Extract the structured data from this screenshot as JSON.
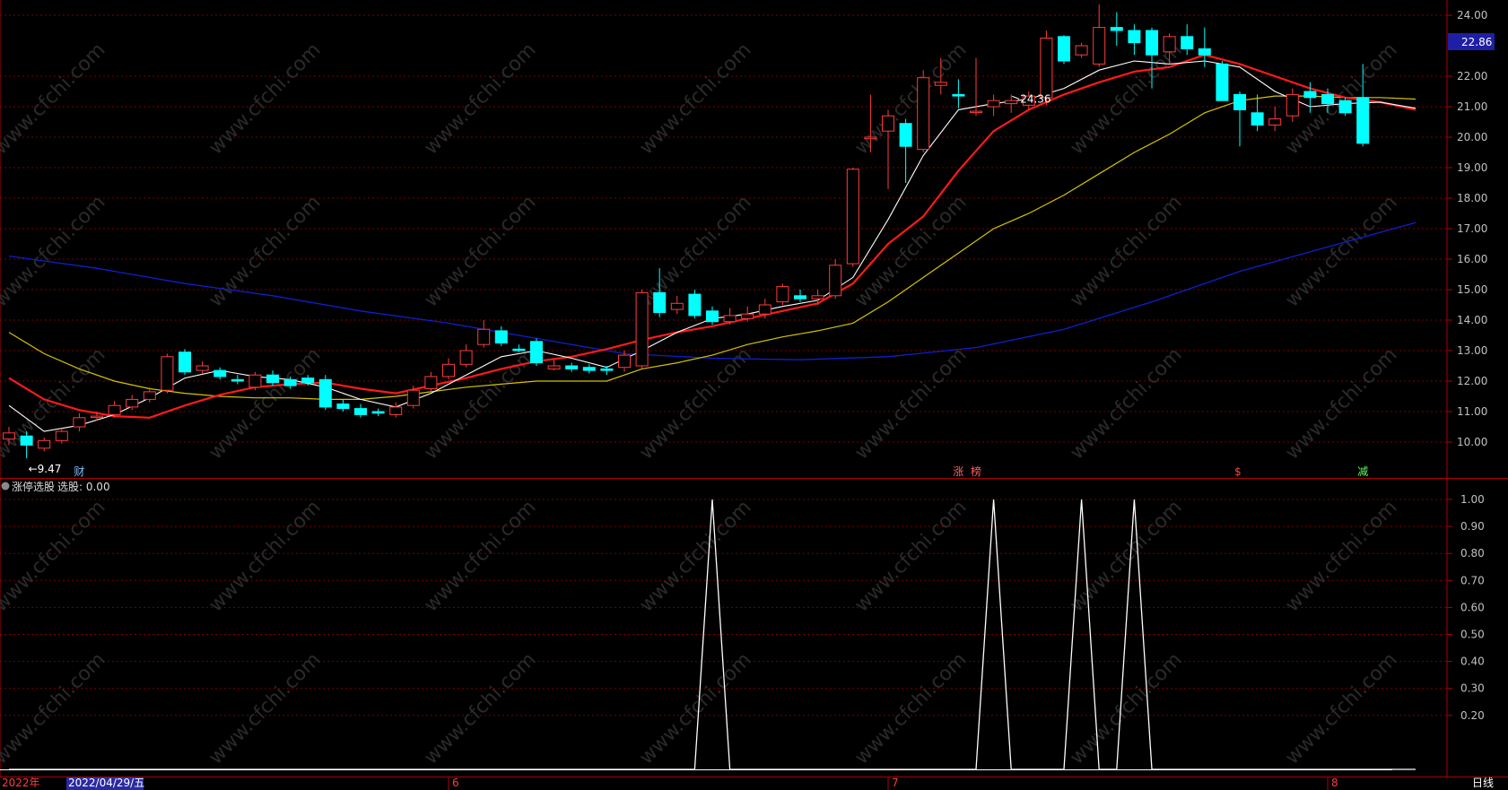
{
  "colors": {
    "background": "#000000",
    "grid": "#7a0000",
    "frame": "#b00000",
    "axis_text": "#c0c0c0",
    "up": "#ff3b3b",
    "down": "#00ffff",
    "ma_white": "#ffffff",
    "ma_red": "#ff1a1a",
    "ma_yellow": "#d4c400",
    "ma_blue": "#0f1fcf",
    "signal": "#ffffff",
    "current_price_bg": "#1f1fa6",
    "date_box_bg": "#2a2aa0"
  },
  "price_axis": {
    "ticks": [
      "24.00",
      "22.00",
      "21.00",
      "20.00",
      "19.00",
      "18.00",
      "17.00",
      "16.00",
      "15.00",
      "14.00",
      "13.00",
      "12.00",
      "11.00",
      "10.00"
    ],
    "current_price": "22.86"
  },
  "indicator_axis": {
    "ticks": [
      "1.00",
      "0.90",
      "0.80",
      "0.70",
      "0.60",
      "0.50",
      "0.40",
      "0.30",
      "0.20"
    ]
  },
  "indicator_header": {
    "name": "涨停选股",
    "value_text": "选股: 0.00"
  },
  "time_axis": {
    "year_label": "2022年",
    "date_box": "2022/04/29/五",
    "months": [
      {
        "label": "6",
        "index": 25
      },
      {
        "label": "7",
        "index": 50
      },
      {
        "label": "8",
        "index": 75
      }
    ]
  },
  "period_label": "日线",
  "extremes": {
    "high": {
      "label": "24.36",
      "index": 57
    },
    "low": {
      "label": "←9.47",
      "index": 1
    }
  },
  "event_markers": [
    {
      "label": "财",
      "index": 4,
      "color": "#7fbfff"
    },
    {
      "label": "涨",
      "index": 54,
      "color": "#ff6060"
    },
    {
      "label": "榜",
      "index": 55,
      "color": "#ff6060"
    },
    {
      "label": "$",
      "index": 70,
      "color": "#ff4040"
    },
    {
      "label": "减",
      "index": 77,
      "color": "#5fff5f"
    }
  ],
  "watermark": "www.cfchi.com",
  "chart_data": [
    {
      "type": "candlestick",
      "title": "日线",
      "ylim": [
        9.2,
        24.6
      ],
      "candles": [
        [
          10.1,
          10.3,
          9.9,
          10.5
        ],
        [
          10.2,
          9.9,
          9.47,
          10.35
        ],
        [
          9.8,
          10.05,
          9.7,
          10.15
        ],
        [
          10.05,
          10.35,
          9.95,
          10.45
        ],
        [
          10.5,
          10.8,
          10.35,
          10.95
        ],
        [
          10.85,
          10.85,
          10.7,
          11.0
        ],
        [
          10.9,
          11.2,
          10.8,
          11.35
        ],
        [
          11.15,
          11.4,
          11.05,
          11.55
        ],
        [
          11.4,
          11.65,
          11.3,
          11.8
        ],
        [
          11.7,
          12.8,
          11.6,
          12.9
        ],
        [
          12.95,
          12.3,
          12.2,
          13.05
        ],
        [
          12.35,
          12.5,
          12.25,
          12.65
        ],
        [
          12.35,
          12.15,
          12.05,
          12.45
        ],
        [
          12.05,
          12.0,
          11.9,
          12.2
        ],
        [
          11.8,
          12.2,
          11.7,
          12.3
        ],
        [
          12.2,
          11.95,
          11.85,
          12.35
        ],
        [
          12.05,
          11.85,
          11.75,
          12.15
        ],
        [
          12.1,
          11.95,
          11.85,
          12.2
        ],
        [
          12.05,
          11.15,
          11.05,
          12.2
        ],
        [
          11.25,
          11.1,
          11.0,
          11.4
        ],
        [
          11.1,
          10.9,
          10.8,
          11.25
        ],
        [
          11.0,
          10.95,
          10.85,
          11.1
        ],
        [
          10.9,
          11.15,
          10.8,
          11.3
        ],
        [
          11.2,
          11.7,
          11.1,
          11.85
        ],
        [
          11.75,
          12.15,
          11.65,
          12.3
        ],
        [
          12.15,
          12.55,
          12.05,
          12.75
        ],
        [
          12.55,
          13.0,
          12.45,
          13.2
        ],
        [
          13.2,
          13.7,
          13.1,
          14.0
        ],
        [
          13.65,
          13.25,
          13.15,
          13.8
        ],
        [
          13.05,
          13.0,
          12.95,
          13.2
        ],
        [
          13.3,
          12.6,
          12.5,
          13.4
        ],
        [
          12.4,
          12.5,
          12.35,
          12.7
        ],
        [
          12.5,
          12.4,
          12.3,
          12.6
        ],
        [
          12.45,
          12.35,
          12.25,
          12.55
        ],
        [
          12.4,
          12.35,
          12.2,
          12.5
        ],
        [
          12.45,
          12.85,
          12.3,
          13.0
        ],
        [
          12.5,
          14.9,
          12.4,
          15.0
        ],
        [
          14.9,
          14.25,
          14.1,
          15.7
        ],
        [
          14.35,
          14.55,
          14.2,
          14.8
        ],
        [
          14.85,
          14.15,
          14.05,
          15.0
        ],
        [
          14.3,
          13.95,
          13.85,
          14.45
        ],
        [
          13.95,
          14.15,
          13.85,
          14.4
        ],
        [
          14.05,
          14.2,
          13.95,
          14.45
        ],
        [
          14.2,
          14.5,
          14.05,
          14.7
        ],
        [
          14.6,
          15.1,
          14.5,
          15.2
        ],
        [
          14.8,
          14.7,
          14.6,
          15.0
        ],
        [
          14.7,
          14.8,
          14.5,
          15.0
        ],
        [
          14.8,
          15.8,
          14.7,
          16.0
        ],
        [
          15.85,
          18.95,
          15.75,
          19.0
        ],
        [
          19.95,
          20.0,
          19.5,
          21.4
        ],
        [
          20.2,
          20.7,
          18.3,
          20.9
        ],
        [
          20.45,
          19.7,
          18.5,
          20.6
        ],
        [
          19.6,
          21.95,
          19.5,
          22.2
        ],
        [
          21.7,
          21.8,
          21.4,
          22.6
        ],
        [
          21.4,
          21.35,
          20.95,
          21.9
        ],
        [
          20.85,
          20.85,
          20.7,
          22.6
        ],
        [
          21.0,
          21.2,
          20.7,
          21.4
        ],
        [
          21.1,
          21.2,
          20.8,
          21.4
        ],
        [
          21.05,
          21.35,
          20.9,
          21.5
        ],
        [
          21.3,
          23.25,
          21.05,
          23.5
        ],
        [
          23.3,
          22.5,
          22.4,
          23.35
        ],
        [
          22.7,
          23.0,
          22.6,
          23.1
        ],
        [
          22.4,
          23.6,
          22.3,
          24.36
        ],
        [
          23.6,
          23.5,
          23.0,
          24.1
        ],
        [
          23.5,
          23.1,
          22.7,
          23.7
        ],
        [
          23.5,
          22.7,
          21.6,
          23.6
        ],
        [
          22.8,
          23.3,
          22.4,
          23.4
        ],
        [
          23.3,
          22.9,
          22.7,
          23.7
        ],
        [
          22.9,
          22.7,
          22.3,
          23.6
        ],
        [
          22.4,
          21.2,
          21.2,
          22.5
        ],
        [
          21.4,
          20.9,
          19.7,
          21.5
        ],
        [
          20.8,
          20.4,
          20.2,
          21.4
        ],
        [
          20.4,
          20.6,
          20.2,
          21.0
        ],
        [
          20.7,
          21.4,
          20.5,
          21.6
        ],
        [
          21.5,
          21.3,
          20.8,
          21.8
        ],
        [
          21.4,
          21.1,
          20.8,
          21.6
        ],
        [
          21.2,
          20.8,
          20.7,
          21.3
        ],
        [
          21.3,
          19.8,
          19.7,
          22.4
        ]
      ],
      "ma_white": [
        [
          0,
          11.2
        ],
        [
          2,
          10.35
        ],
        [
          4,
          10.55
        ],
        [
          6,
          10.9
        ],
        [
          8,
          11.45
        ],
        [
          10,
          12.1
        ],
        [
          12,
          12.35
        ],
        [
          14,
          12.15
        ],
        [
          16,
          12.05
        ],
        [
          18,
          11.8
        ],
        [
          20,
          11.4
        ],
        [
          22,
          11.15
        ],
        [
          24,
          11.6
        ],
        [
          26,
          12.2
        ],
        [
          28,
          12.8
        ],
        [
          30,
          13.0
        ],
        [
          32,
          12.75
        ],
        [
          34,
          12.45
        ],
        [
          36,
          13.0
        ],
        [
          38,
          13.6
        ],
        [
          40,
          14.05
        ],
        [
          42,
          14.2
        ],
        [
          44,
          14.45
        ],
        [
          46,
          14.65
        ],
        [
          48,
          15.4
        ],
        [
          50,
          17.3
        ],
        [
          52,
          19.4
        ],
        [
          54,
          20.9
        ],
        [
          56,
          21.1
        ],
        [
          58,
          21.25
        ],
        [
          60,
          21.6
        ],
        [
          62,
          22.2
        ],
        [
          64,
          22.5
        ],
        [
          66,
          22.4
        ],
        [
          68,
          22.5
        ],
        [
          70,
          22.3
        ],
        [
          72,
          21.5
        ],
        [
          74,
          21.0
        ],
        [
          76,
          21.1
        ],
        [
          78,
          21.15
        ],
        [
          80,
          20.95
        ]
      ],
      "ma_red": [
        [
          0,
          12.1
        ],
        [
          2,
          11.4
        ],
        [
          4,
          11.05
        ],
        [
          6,
          10.85
        ],
        [
          8,
          10.8
        ],
        [
          10,
          11.2
        ],
        [
          12,
          11.55
        ],
        [
          14,
          11.8
        ],
        [
          16,
          11.9
        ],
        [
          18,
          11.95
        ],
        [
          20,
          11.75
        ],
        [
          22,
          11.6
        ],
        [
          24,
          11.85
        ],
        [
          26,
          12.1
        ],
        [
          28,
          12.4
        ],
        [
          30,
          12.65
        ],
        [
          32,
          12.8
        ],
        [
          34,
          13.05
        ],
        [
          36,
          13.35
        ],
        [
          38,
          13.6
        ],
        [
          40,
          13.8
        ],
        [
          42,
          14.05
        ],
        [
          44,
          14.3
        ],
        [
          46,
          14.55
        ],
        [
          48,
          15.2
        ],
        [
          50,
          16.5
        ],
        [
          52,
          17.4
        ],
        [
          54,
          18.9
        ],
        [
          56,
          20.2
        ],
        [
          58,
          20.9
        ],
        [
          60,
          21.4
        ],
        [
          62,
          21.8
        ],
        [
          64,
          22.15
        ],
        [
          66,
          22.3
        ],
        [
          68,
          22.7
        ],
        [
          70,
          22.4
        ],
        [
          72,
          22.0
        ],
        [
          74,
          21.6
        ],
        [
          76,
          21.3
        ],
        [
          78,
          21.15
        ],
        [
          80,
          20.9
        ]
      ],
      "ma_yellow": [
        [
          0,
          13.6
        ],
        [
          2,
          12.9
        ],
        [
          4,
          12.4
        ],
        [
          6,
          12.0
        ],
        [
          8,
          11.75
        ],
        [
          10,
          11.6
        ],
        [
          12,
          11.5
        ],
        [
          14,
          11.45
        ],
        [
          16,
          11.45
        ],
        [
          18,
          11.4
        ],
        [
          20,
          11.4
        ],
        [
          22,
          11.5
        ],
        [
          24,
          11.65
        ],
        [
          26,
          11.8
        ],
        [
          28,
          11.9
        ],
        [
          30,
          12.0
        ],
        [
          32,
          12.0
        ],
        [
          34,
          12.0
        ],
        [
          36,
          12.4
        ],
        [
          38,
          12.6
        ],
        [
          40,
          12.85
        ],
        [
          42,
          13.2
        ],
        [
          44,
          13.45
        ],
        [
          46,
          13.65
        ],
        [
          48,
          13.9
        ],
        [
          50,
          14.6
        ],
        [
          52,
          15.4
        ],
        [
          54,
          16.2
        ],
        [
          56,
          17.0
        ],
        [
          58,
          17.5
        ],
        [
          60,
          18.1
        ],
        [
          62,
          18.8
        ],
        [
          64,
          19.5
        ],
        [
          66,
          20.1
        ],
        [
          68,
          20.8
        ],
        [
          70,
          21.2
        ],
        [
          72,
          21.35
        ],
        [
          74,
          21.35
        ],
        [
          76,
          21.3
        ],
        [
          78,
          21.3
        ],
        [
          80,
          21.25
        ]
      ],
      "ma_blue": [
        [
          0,
          16.1
        ],
        [
          5,
          15.7
        ],
        [
          10,
          15.2
        ],
        [
          15,
          14.8
        ],
        [
          20,
          14.3
        ],
        [
          25,
          13.9
        ],
        [
          30,
          13.4
        ],
        [
          35,
          12.9
        ],
        [
          40,
          12.75
        ],
        [
          45,
          12.7
        ],
        [
          50,
          12.8
        ],
        [
          55,
          13.1
        ],
        [
          60,
          13.7
        ],
        [
          65,
          14.6
        ],
        [
          70,
          15.6
        ],
        [
          75,
          16.4
        ],
        [
          80,
          17.2
        ]
      ]
    },
    {
      "type": "line",
      "title": "涨停选股",
      "ylim": [
        0,
        1.0
      ],
      "x": [
        0,
        39,
        40,
        41,
        55,
        56,
        57,
        60,
        61,
        62,
        63,
        64,
        65,
        66,
        80
      ],
      "values": [
        0,
        0,
        1,
        0,
        0,
        1,
        0,
        0,
        1,
        0,
        0,
        1,
        0,
        0,
        0
      ]
    }
  ]
}
